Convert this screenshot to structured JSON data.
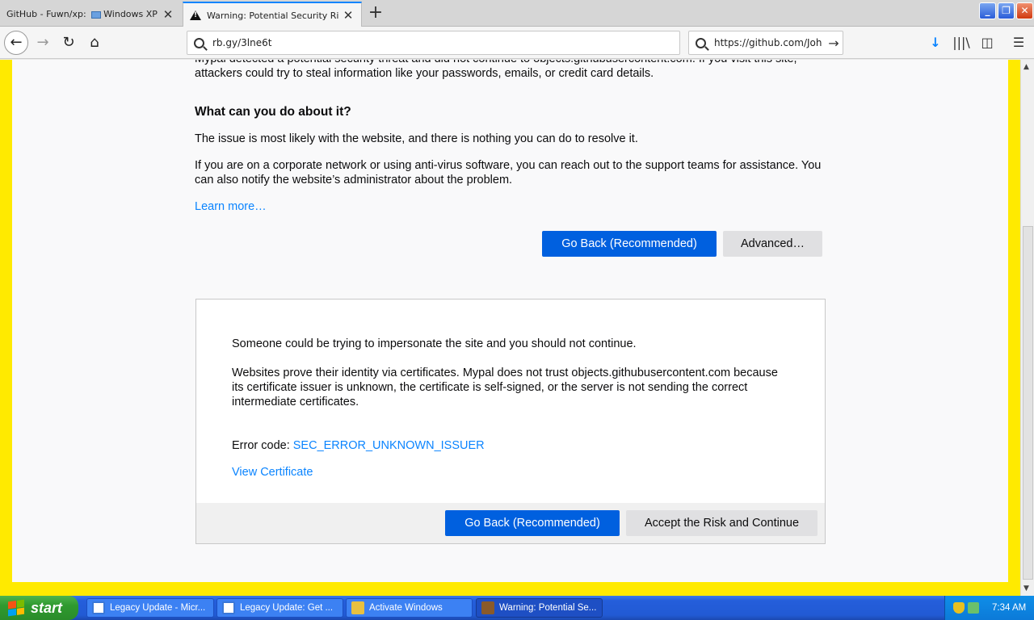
{
  "tabs": [
    {
      "title_a": "GitHub - Fuwn/xp: ",
      "title_b": "Windows XP All E",
      "close": "✕"
    },
    {
      "title": "Warning: Potential Security Risk A",
      "close": "✕"
    }
  ],
  "new_tab": "+",
  "caption": {
    "min": "_",
    "max": "❐",
    "close": "✕"
  },
  "nav": {
    "back": "←",
    "forward": "→",
    "reload": "↻",
    "home": "⌂",
    "url": "rb.gy/3lne6t",
    "search_value": "https://github.com/Joh",
    "go": "→"
  },
  "toolbar": {
    "download": "↓",
    "library": "|||\\",
    "sidebar": "◫",
    "menu": "☰"
  },
  "page": {
    "intro_line1": "Mypal detected a potential security threat and did not continue to objects.githubusercontent.com. If you visit this site,",
    "intro_line2": "attackers could try to steal information like your passwords, emails, or credit card details.",
    "what_heading": "What can you do about it?",
    "issue_text": "The issue is most likely with the website, and there is nothing you can do to resolve it.",
    "corp_text": "If you are on a corporate network or using anti-virus software, you can reach out to the support teams for assistance. You can also notify the website’s administrator about the problem.",
    "learn_more": "Learn more…",
    "go_back": "Go Back (Recommended)",
    "advanced": "Advanced…",
    "impersonate": "Someone could be trying to impersonate the site and you should not continue.",
    "cert_text": "Websites prove their identity via certificates. Mypal does not trust objects.githubusercontent.com because its certificate issuer is unknown, the certificate is self-signed, or the server is not sending the correct intermediate certificates.",
    "error_code_label": "Error code: ",
    "error_code": "SEC_ERROR_UNKNOWN_ISSUER",
    "view_cert": "View Certificate",
    "accept": "Accept the Risk and Continue"
  },
  "taskbar": {
    "start": "start",
    "items": [
      {
        "label": "Legacy Update - Micr..."
      },
      {
        "label": "Legacy Update: Get ..."
      },
      {
        "label": "Activate Windows"
      },
      {
        "label": "Warning: Potential Se..."
      }
    ],
    "clock": "7:34 AM"
  },
  "colors": {
    "page_border": "#ffea00",
    "primary": "#0060df",
    "link": "#0a84ff"
  }
}
